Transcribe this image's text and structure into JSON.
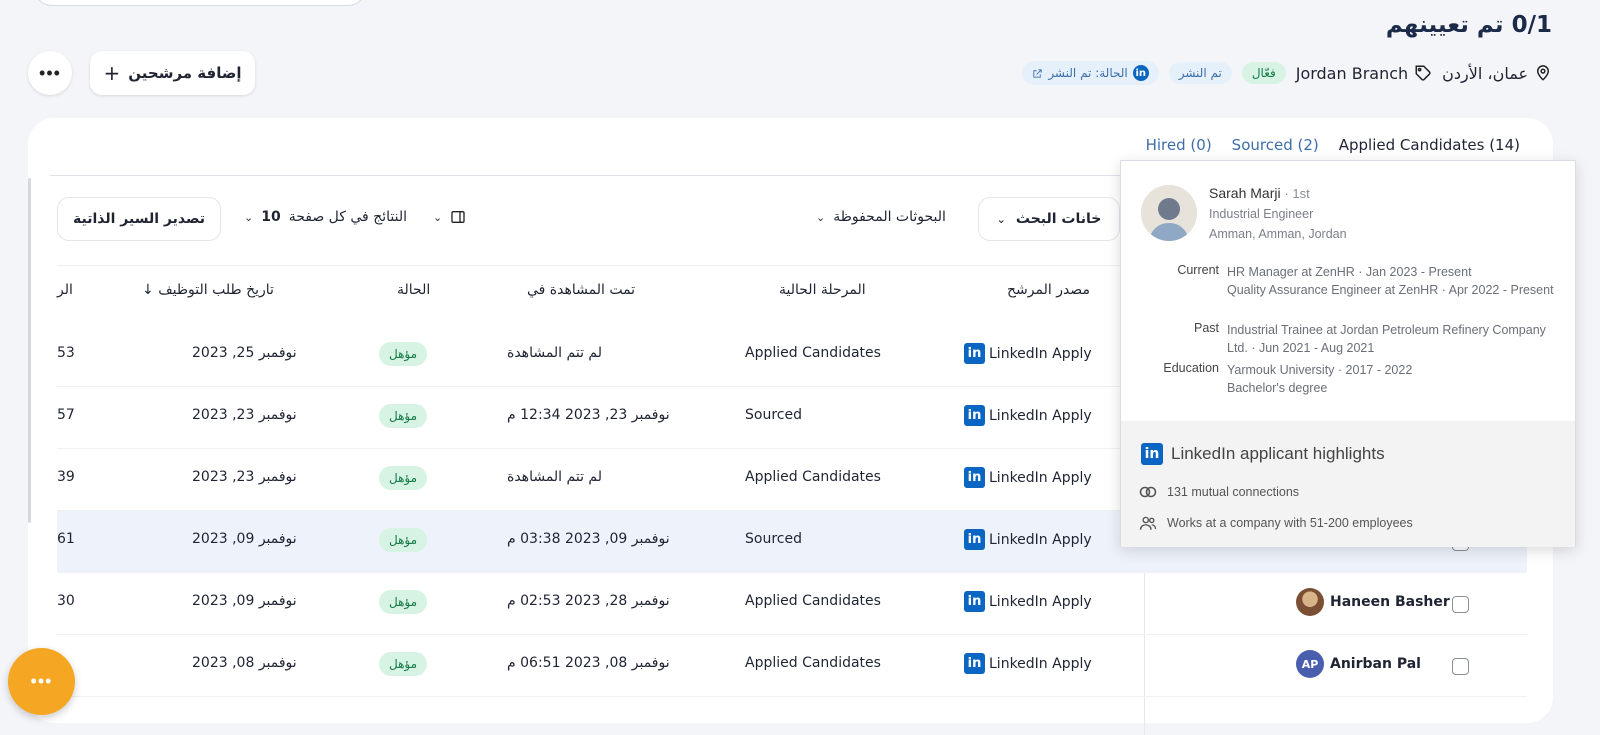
{
  "header": {
    "title": "0/1 تم تعيينهم",
    "location": "عمان، الأردن",
    "branch": "Jordan Branch",
    "badges": {
      "active": "فعّال",
      "published": "تم النشر",
      "li_status": "الحالة: تم النشر"
    },
    "add_candidates": "إضافة مرشحين",
    "more": "•••"
  },
  "tabs": [
    "Applied Candidates",
    "(14)",
    "(2) Sourced",
    "(0) Hired"
  ],
  "toolbar": {
    "search_fields": "خانات البحث",
    "saved_searches": "البحوثات المحفوظة",
    "results_per_page": "النتائج في كل صفحة",
    "per_page_value": "10",
    "export_cvs": "تصدير السير الذاتية"
  },
  "table": {
    "headers": {
      "source": "مصدر المرشح",
      "stage": "المرحلة الحالية",
      "viewed": "تمت المشاهدة في",
      "status": "الحالة",
      "applied_date": "تاريخ طلب التوظيف",
      "cut": "الر"
    },
    "rows": [
      {
        "cut": "53",
        "applied": "نوفمبر 25, 2023",
        "status": "مؤهل",
        "viewed": "لم تتم المشاهدة",
        "stage": "Applied Candidates",
        "source": "LinkedIn Apply",
        "name": ""
      },
      {
        "cut": "57",
        "applied": "نوفمبر 23, 2023",
        "status": "مؤهل",
        "viewed": "نوفمبر 23, 2023 12:34 م",
        "stage": "Sourced",
        "source": "LinkedIn Apply",
        "name": ""
      },
      {
        "cut": "39",
        "applied": "نوفمبر 23, 2023",
        "status": "مؤهل",
        "viewed": "لم تتم المشاهدة",
        "stage": "Applied Candidates",
        "source": "LinkedIn Apply",
        "name": ""
      },
      {
        "cut": "61",
        "applied": "نوفمبر 09, 2023",
        "status": "مؤهل",
        "viewed": "نوفمبر 09, 2023 03:38 م",
        "stage": "Sourced",
        "source": "LinkedIn Apply",
        "name": ""
      },
      {
        "cut": "30",
        "applied": "نوفمبر 09, 2023",
        "status": "مؤهل",
        "viewed": "نوفمبر 28, 2023 02:53 م",
        "stage": "Applied Candidates",
        "source": "LinkedIn Apply",
        "name": "Haneen Basher"
      },
      {
        "cut": "",
        "applied": "نوفمبر 08, 2023",
        "status": "مؤهل",
        "viewed": "نوفمبر 08, 2023 06:51 م",
        "stage": "Applied Candidates",
        "source": "LinkedIn Apply",
        "name": "Anirban Pal",
        "initials": "AP"
      }
    ]
  },
  "popover": {
    "name": "Sarah Marji",
    "degree": "· 1st",
    "headline": "Industrial Engineer",
    "location": "Amman, Amman, Jordan",
    "current_label": "Current",
    "current_1": "HR Manager at ZenHR · Jan 2023 - Present",
    "current_2": "Quality Assurance Engineer at ZenHR · Apr 2022 - Present",
    "past_label": "Past",
    "past_1": "Industrial Trainee at Jordan Petroleum Refinery Company Ltd. · Jun 2021 - Aug 2021",
    "education_label": "Education",
    "education_1": "Yarmouk University · 2017 - 2022",
    "education_2": "Bachelor's degree",
    "highlights_title": "LinkedIn applicant highlights",
    "highlight_1": "131 mutual connections",
    "highlight_2": "Works at a company with 51-200 employees"
  },
  "fab": "•••",
  "colors": {
    "linkedin": "#0a66c2",
    "fab": "#f5a623",
    "qualified_bg": "#d7f3e4",
    "qualified_fg": "#157a46"
  }
}
